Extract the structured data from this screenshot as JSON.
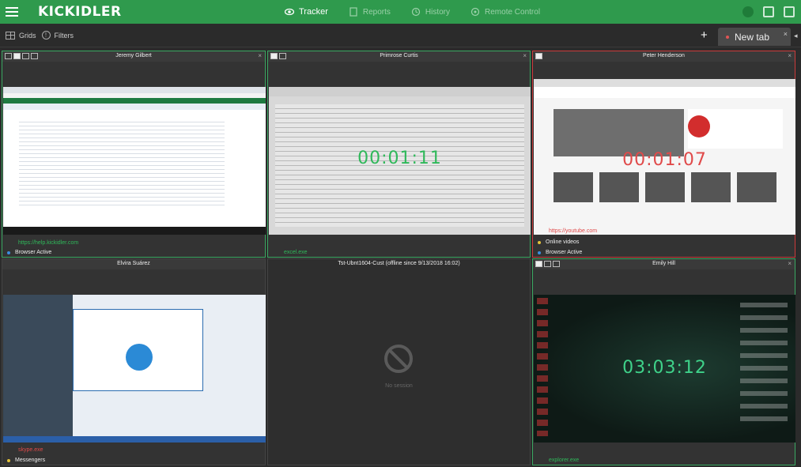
{
  "app": {
    "logo": "KICKIDLER"
  },
  "nav": [
    {
      "label": "Tracker",
      "icon": "eye-icon",
      "active": true
    },
    {
      "label": "Reports",
      "icon": "report-icon",
      "active": false
    },
    {
      "label": "History",
      "icon": "history-icon",
      "active": false
    },
    {
      "label": "Remote Control",
      "icon": "remote-control-icon",
      "active": false
    }
  ],
  "toolbar": {
    "grids_label": "Grids",
    "filters_label": "Filters",
    "add_tab": "+",
    "tab_label": "New tab",
    "tab_close": "×"
  },
  "colors": {
    "brand": "#2f9a4d",
    "active_border": "#3aa862",
    "alert_border": "#cc3b3b",
    "timer_green": "#2fb85a",
    "timer_red": "#e04a4a"
  },
  "panes": {
    "jeremy": {
      "name": "Jeremy Gilbert",
      "url": "https://help.kickidler.com",
      "status": "Browser Active"
    },
    "primrose": {
      "name": "Primrose  Curtis",
      "timer": "00:01:11",
      "process": "excel.exe"
    },
    "peter": {
      "name": "Peter Henderson",
      "timer": "00:01:07",
      "url": "https://youtube.com",
      "status1": "Online videos",
      "status2": "Browser Active"
    },
    "elvira": {
      "name": "Elvira Suárez",
      "process": "skype.exe",
      "status": "Messengers"
    },
    "offline": {
      "name": "Tst-Ubnt1604-Cust (offline since 9/13/2018 16:02)",
      "label": "No session"
    },
    "emily": {
      "name": "Emily Hill",
      "timer": "03:03:12",
      "process": "explorer.exe"
    }
  }
}
